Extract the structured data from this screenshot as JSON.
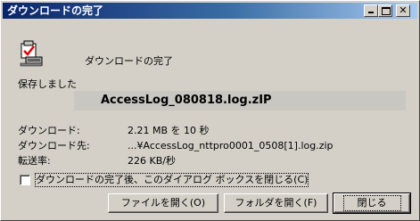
{
  "window": {
    "title": "ダウンロードの完了"
  },
  "message": "ダウンロードの完了",
  "saved_label": "保存しました",
  "filename": "AccessLog_080818.log.zIP",
  "details": {
    "download_label": "ダウンロード:",
    "download_value": "2.21 MB を 10 秒",
    "dest_label": "ダウンロード先:",
    "dest_value": "...¥AccessLog_nttpro0001_0508[1].log.zip",
    "rate_label": "転送率:",
    "rate_value": "226 KB/秒"
  },
  "checkbox": {
    "label": "ダウンロードの完了後、このダイアログ ボックスを閉じる(C)",
    "checked": false
  },
  "buttons": {
    "open": "ファイルを開く(O)",
    "open_folder": "フォルダを開く(F)",
    "close": "閉じる"
  }
}
